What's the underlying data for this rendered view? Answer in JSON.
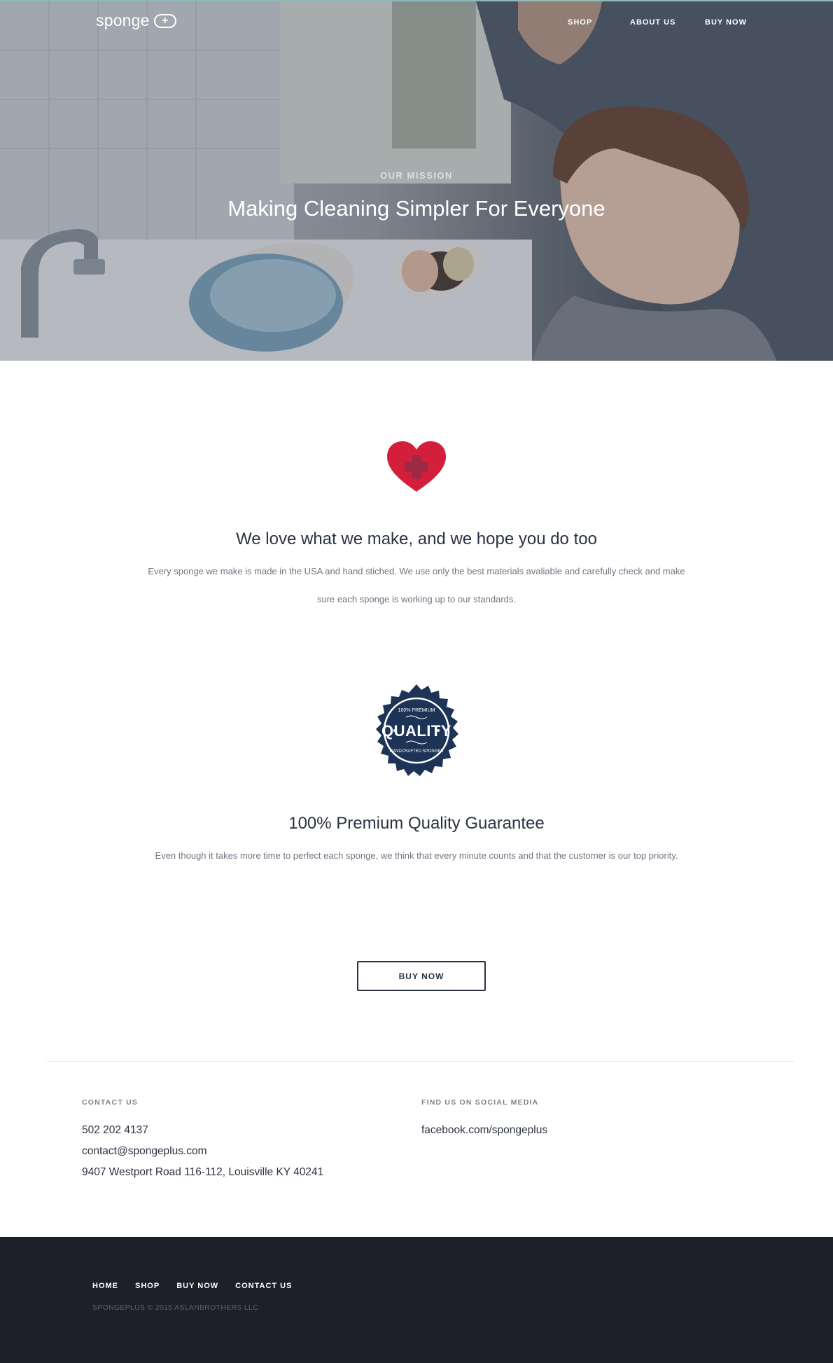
{
  "header": {
    "logo_text": "sponge",
    "logo_badge": "+",
    "nav": [
      {
        "label": "SHOP"
      },
      {
        "label": "ABOUT US"
      },
      {
        "label": "BUY NOW"
      }
    ]
  },
  "hero": {
    "eyebrow": "OUR MISSION",
    "title": "Making Cleaning Simpler For Everyone"
  },
  "love": {
    "icon": "heart-plus-icon",
    "title": "We love what we make, and we hope you do too",
    "body": "Every sponge we make is made in the USA and hand stiched. We use only the best materials avaliable and carefully check and make sure each sponge is working up to our standards."
  },
  "quality": {
    "badge": {
      "top": "100% PREMIUM",
      "main": "QUALITY",
      "bottom": "HANDCRAFTED SPONGES"
    },
    "title": "100% Premium Quality Guarantee",
    "body": "Even though it takes more time to perfect each sponge, we think that every minute counts and that the customer is our top priority."
  },
  "cta": {
    "label": "BUY NOW"
  },
  "contact": {
    "heading": "CONTACT US",
    "phone": "502 202 4137",
    "email": "contact@spongeplus.com",
    "address": "9407 Westport Road 116-112, Louisville KY 40241"
  },
  "social": {
    "heading": "FIND US ON SOCIAL MEDIA",
    "facebook": "facebook.com/spongeplus"
  },
  "footer": {
    "nav": [
      {
        "label": "HOME"
      },
      {
        "label": "SHOP"
      },
      {
        "label": "BUY NOW"
      },
      {
        "label": "CONTACT US"
      }
    ],
    "copyright": "SPONGEPLUS © 2015 ASLANBROTHERS LLC"
  },
  "colors": {
    "accent_red": "#d41f3c",
    "navy": "#1e3457",
    "footer_bg": "#1d2028"
  }
}
